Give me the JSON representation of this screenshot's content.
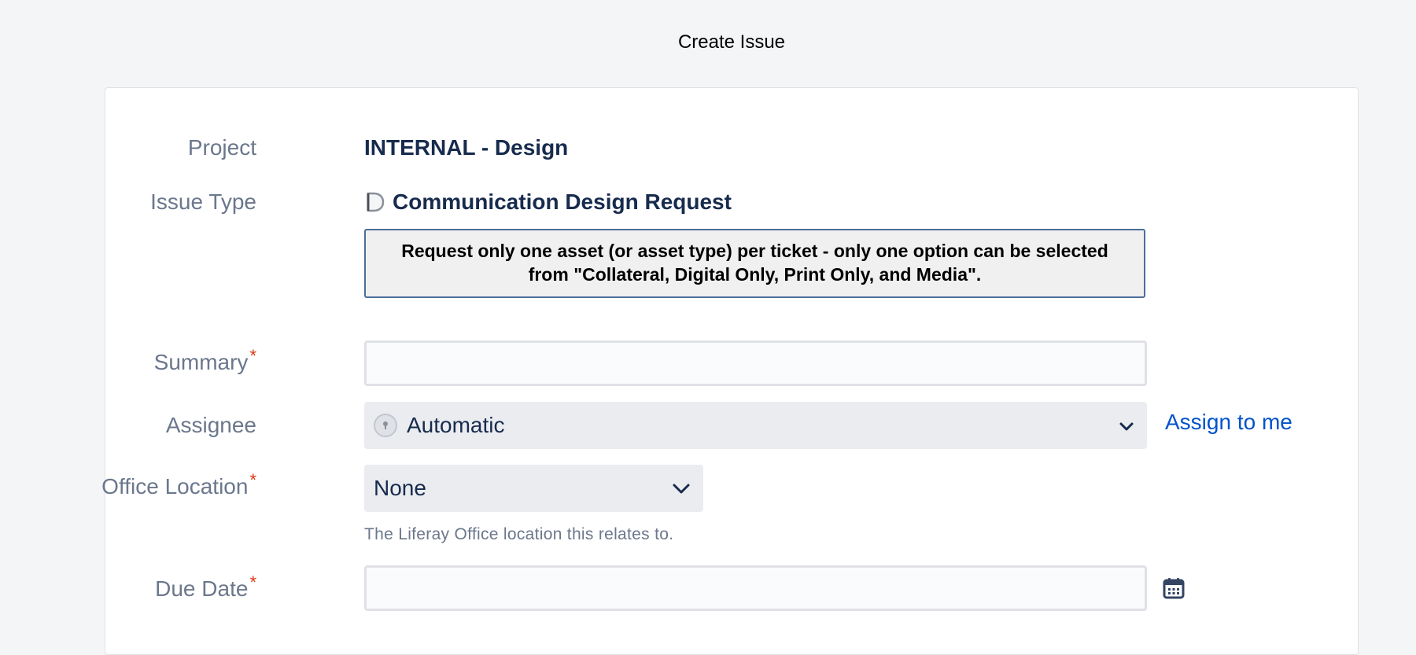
{
  "page": {
    "title": "Create Issue"
  },
  "form": {
    "project": {
      "label": "Project",
      "value": "INTERNAL - Design"
    },
    "issue_type": {
      "label": "Issue Type",
      "value": "Communication Design Request",
      "icon": "design-request-icon"
    },
    "notice": "Request only one asset (or asset type) per ticket - only one option can be selected from \"Collateral, Digital Only, Print Only, and Media\".",
    "summary": {
      "label": "Summary",
      "required_marker": "*",
      "value": "",
      "placeholder": ""
    },
    "assignee": {
      "label": "Assignee",
      "value": "Automatic",
      "assign_to_me": "Assign to me"
    },
    "office_location": {
      "label": "Office Location",
      "required_marker": "*",
      "value": "None",
      "help": "The Liferay Office location this relates to."
    },
    "due_date": {
      "label": "Due Date",
      "required_marker": "*",
      "value": "",
      "placeholder": ""
    }
  },
  "colors": {
    "background": "#f4f5f7",
    "label": "#6b778c",
    "text_strong": "#172b4d",
    "required": "#de350b",
    "link": "#0052cc",
    "notice_border": "#4c6e9a"
  }
}
